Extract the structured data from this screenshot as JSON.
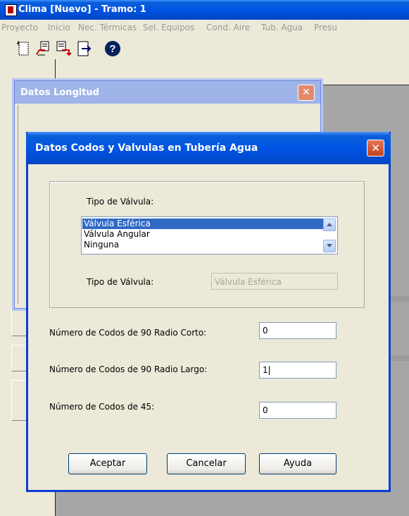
{
  "main_window": {
    "title": "Clima [Nuevo] - Tramo: 1",
    "menu": [
      "Proyecto",
      "Inicio",
      "Nec. Térmicas",
      "Sel. Equipos",
      "Cond. Aire",
      "Tub. Agua",
      "Presu"
    ]
  },
  "toolbar": {
    "icons": [
      "new-file-icon",
      "open-file-icon",
      "save-file-icon",
      "exit-icon",
      "help-icon"
    ],
    "help_glyph": "?"
  },
  "back_dialog": {
    "title": "Datos Longitud",
    "close_glyph": "✕"
  },
  "dialog": {
    "title": "Datos Codos y Valvulas en Tubería Agua",
    "close_glyph": "✕",
    "valve_type_label": "Tipo de Válvula:",
    "valve_options": [
      "Válvula Esférica",
      "Válvula Angular",
      "Ninguna"
    ],
    "selected_index": 0,
    "selected_label": "Tipo de Válvula:",
    "selected_value": "Válvula Esférica",
    "fields": [
      {
        "label": "Número de Codos de 90 Radio Corto:",
        "value": "0"
      },
      {
        "label": "Número de Codos de 90 Radio Largo:",
        "value": "1"
      },
      {
        "label": "Número de Codos de 45:",
        "value": "0"
      }
    ],
    "buttons": {
      "accept": "Aceptar",
      "cancel": "Cancelar",
      "help": "Ayuda"
    }
  }
}
